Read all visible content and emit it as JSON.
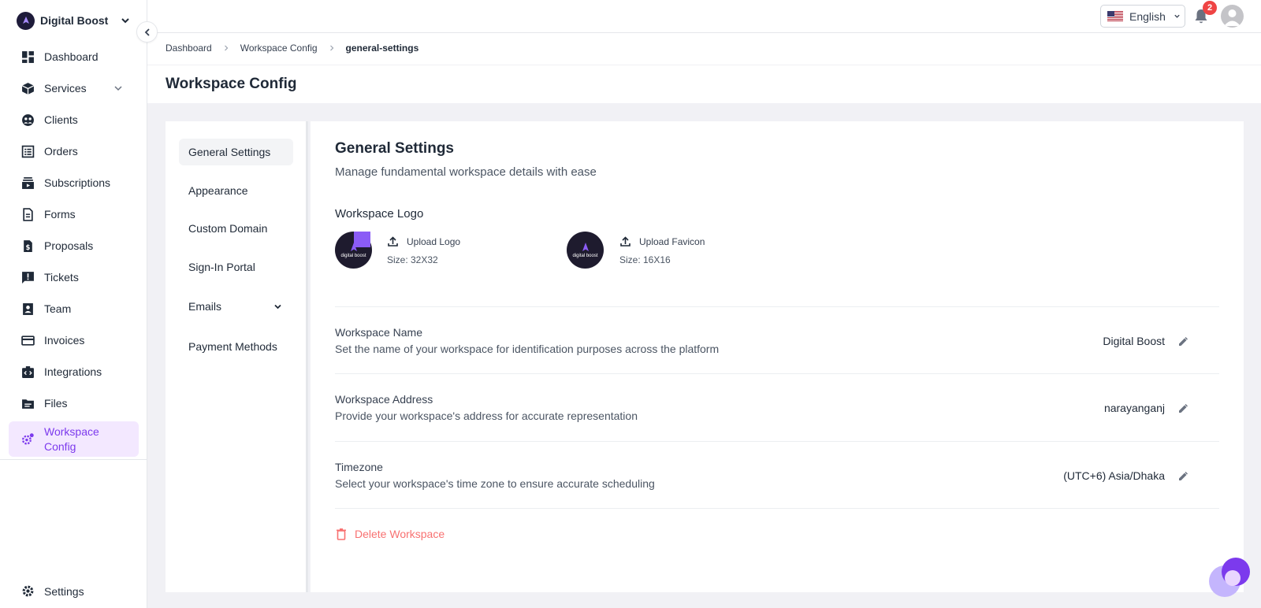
{
  "brand": {
    "name": "Digital Boost"
  },
  "sidebar": {
    "items": [
      {
        "label": "Dashboard",
        "icon": "dashboard-icon"
      },
      {
        "label": "Services",
        "icon": "box-icon",
        "has_submenu": true
      },
      {
        "label": "Clients",
        "icon": "clients-icon"
      },
      {
        "label": "Orders",
        "icon": "orders-icon"
      },
      {
        "label": "Subscriptions",
        "icon": "subscriptions-icon"
      },
      {
        "label": "Forms",
        "icon": "forms-icon"
      },
      {
        "label": "Proposals",
        "icon": "proposals-icon"
      },
      {
        "label": "Tickets",
        "icon": "tickets-icon"
      },
      {
        "label": "Team",
        "icon": "team-icon"
      },
      {
        "label": "Invoices",
        "icon": "invoices-icon"
      },
      {
        "label": "Integrations",
        "icon": "integrations-icon"
      },
      {
        "label": "Files",
        "icon": "files-icon"
      },
      {
        "label_line1": "Workspace",
        "label_line2": "Config",
        "icon": "workspace-config-icon",
        "active": true
      }
    ],
    "settings_label": "Settings"
  },
  "topbar": {
    "language": "English",
    "notification_count": "2"
  },
  "breadcrumb": {
    "items": [
      "Dashboard",
      "Workspace Config",
      "general-settings"
    ]
  },
  "page": {
    "title": "Workspace Config"
  },
  "subnav": {
    "items": [
      "General Settings",
      "Appearance",
      "Custom Domain",
      "Sign-In Portal",
      "Emails",
      "Payment Methods"
    ]
  },
  "general": {
    "title": "General Settings",
    "description": "Manage fundamental workspace details with ease",
    "logo_section_label": "Workspace Logo",
    "logo_text": "digital boost",
    "upload_logo_label": "Upload Logo",
    "logo_size": "Size: 32X32",
    "upload_favicon_label": "Upload Favicon",
    "favicon_size": "Size: 16X16",
    "fields": [
      {
        "title": "Workspace Name",
        "description": "Set the name of your workspace for identification purposes across the platform",
        "value": "Digital Boost"
      },
      {
        "title": "Workspace Address",
        "description": "Provide your workspace's address for accurate representation",
        "value": "narayanganj"
      },
      {
        "title": "Timezone",
        "description": "Select your workspace's time zone to ensure accurate scheduling",
        "value": "(UTC+6) Asia/Dhaka"
      }
    ],
    "delete_label": "Delete Workspace"
  },
  "colors": {
    "accent": "#7c3aed",
    "active_bg": "#f3e8ff",
    "danger": "#f87171",
    "badge": "#ef4444"
  }
}
